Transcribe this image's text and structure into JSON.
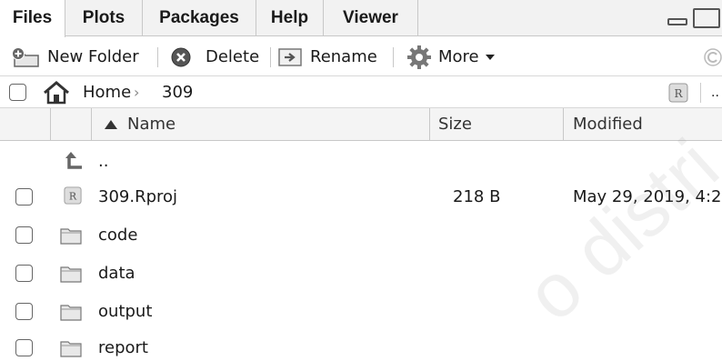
{
  "tabs": [
    {
      "label": "Files",
      "active": true
    },
    {
      "label": "Plots",
      "active": false
    },
    {
      "label": "Packages",
      "active": false
    },
    {
      "label": "Help",
      "active": false
    },
    {
      "label": "Viewer",
      "active": false
    }
  ],
  "toolbar": {
    "new_folder": "New Folder",
    "delete": "Delete",
    "rename": "Rename",
    "more": "More",
    "refresh_icon": "refresh-icon"
  },
  "breadcrumb": {
    "home": "Home",
    "folder": "309",
    "overflow": ".."
  },
  "table": {
    "headers": {
      "name": "Name",
      "size": "Size",
      "modified": "Modified"
    },
    "parent": "..",
    "rows": [
      {
        "name": "309.Rproj",
        "type": "rproj",
        "size": "218 B",
        "modified": "May 29, 2019, 4:2"
      },
      {
        "name": "code",
        "type": "folder",
        "size": "",
        "modified": ""
      },
      {
        "name": "data",
        "type": "folder",
        "size": "",
        "modified": ""
      },
      {
        "name": "output",
        "type": "folder",
        "size": "",
        "modified": ""
      },
      {
        "name": "report",
        "type": "folder",
        "size": "",
        "modified": ""
      }
    ]
  },
  "watermark": "o distri",
  "colors": {
    "tabbar_bg": "#f2f2f2",
    "header_bg": "#f4f4f4",
    "border": "#c8c8c8"
  }
}
